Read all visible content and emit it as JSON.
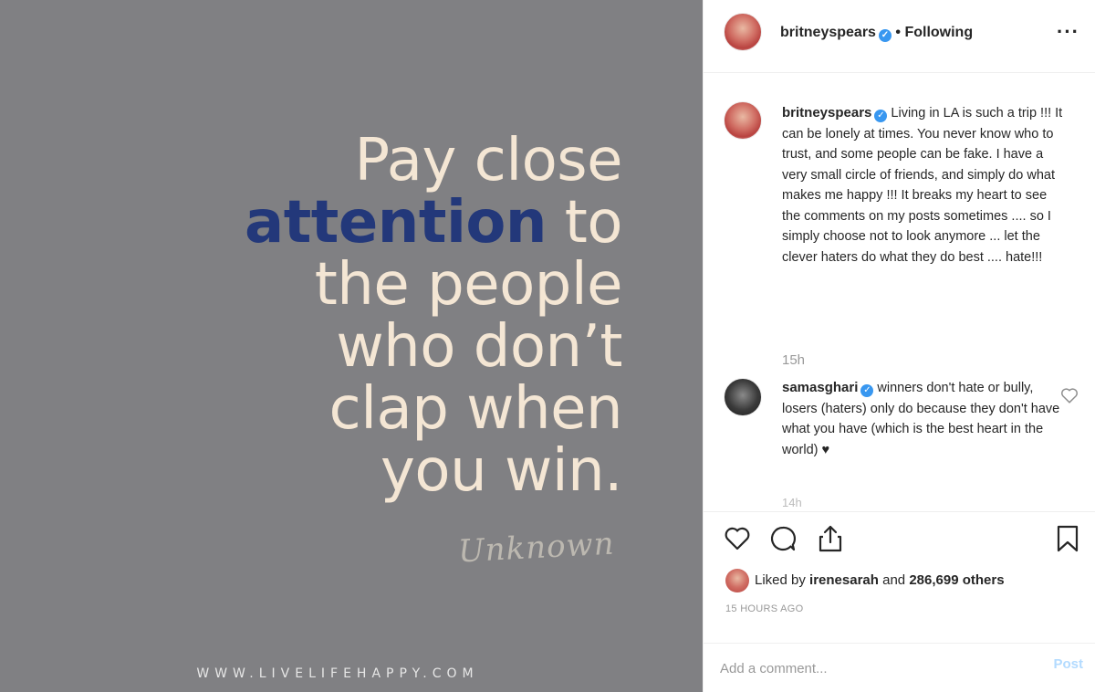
{
  "image": {
    "quote_lines": [
      [
        "Pay close"
      ],
      [
        "attention",
        " to"
      ],
      [
        "the people"
      ],
      [
        "who don’t"
      ],
      [
        "clap when"
      ],
      [
        "you win."
      ]
    ],
    "attribution": "Unknown",
    "website": "WWW.LIVELIFEHAPPY.COM",
    "colors": {
      "background": "#808083",
      "text": "#f4e6d4",
      "accent": "#23387a"
    }
  },
  "post": {
    "header": {
      "username": "britneyspears",
      "separator": "•",
      "follow_status": "Following",
      "more_label": "···"
    },
    "caption": {
      "username": "britneyspears",
      "text": "Living in LA is such a trip !!! It can be lonely at times. You never know who to trust, and some people can be fake. I have a very small circle of friends, and simply do what makes me happy !!! It breaks my heart to see the comments on my posts sometimes .... so I simply choose not to look anymore ... let the clever haters do what they do best .... hate!!!",
      "time": "15h"
    },
    "comment": {
      "username": "samasghari",
      "text": "winners don't hate or bully, losers (haters) only do because they don't have what you have (which is the best heart in the world) ♥",
      "time": "14h"
    },
    "likes": {
      "prefix": "Liked by ",
      "user": "irenesarah",
      "middle": " and ",
      "others": "286,699 others"
    },
    "timestamp": "15 HOURS AGO",
    "add_comment_placeholder": "Add a comment...",
    "post_label": "Post",
    "icons": [
      "heart-icon",
      "comment-icon",
      "share-icon",
      "bookmark-icon",
      "verified-icon"
    ],
    "colors": {
      "verified": "#3897f0",
      "post_button": "#b3dbff",
      "muted": "#999999"
    }
  }
}
